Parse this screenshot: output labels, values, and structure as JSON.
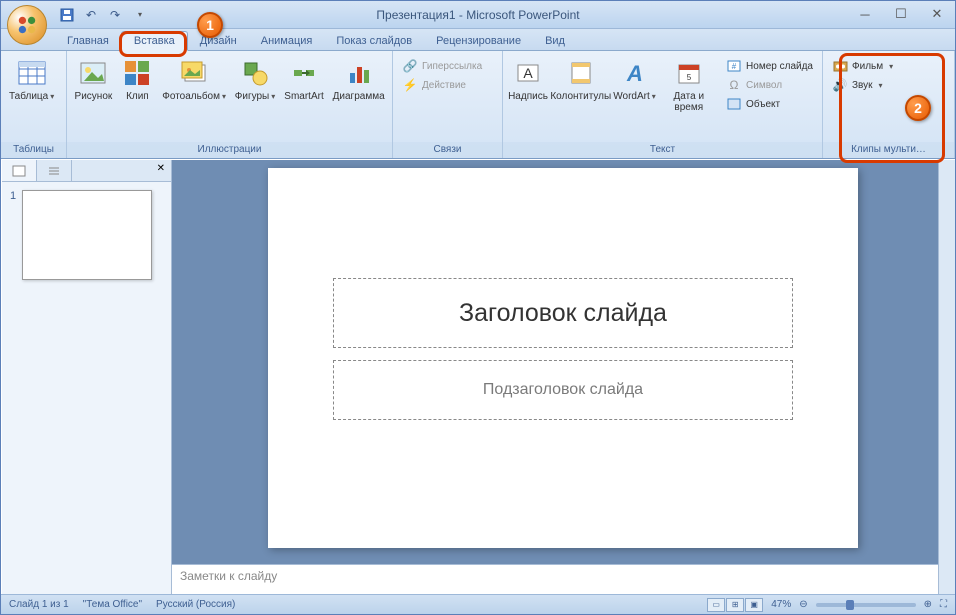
{
  "title": "Презентация1 - Microsoft PowerPoint",
  "tabs": [
    "Главная",
    "Вставка",
    "Дизайн",
    "Анимация",
    "Показ слайдов",
    "Рецензирование",
    "Вид"
  ],
  "active_tab_index": 1,
  "ribbon": {
    "tables": {
      "label": "Таблицы",
      "btn": "Таблица"
    },
    "illustrations": {
      "label": "Иллюстрации",
      "picture": "Рисунок",
      "clip": "Клип",
      "album": "Фотоальбом",
      "shapes": "Фигуры",
      "smartart": "SmartArt",
      "chart": "Диаграмма"
    },
    "links": {
      "label": "Связи",
      "hyperlink": "Гиперссылка",
      "action": "Действие"
    },
    "text": {
      "label": "Текст",
      "textbox": "Надпись",
      "headerfooter": "Колонтитулы",
      "wordart": "WordArt",
      "datetime": "Дата и время",
      "slidenum": "Номер слайда",
      "symbol": "Символ",
      "object": "Объект"
    },
    "media": {
      "label": "Клипы мульти…",
      "movie": "Фильм",
      "sound": "Звук"
    }
  },
  "slide": {
    "title_placeholder": "Заголовок слайда",
    "subtitle_placeholder": "Подзаголовок слайда"
  },
  "notes_placeholder": "Заметки к слайду",
  "status": {
    "slide_info": "Слайд 1 из 1",
    "theme": "\"Тема Office\"",
    "language": "Русский (Россия)",
    "zoom": "47%"
  },
  "annotations": {
    "1": "1",
    "2": "2"
  }
}
